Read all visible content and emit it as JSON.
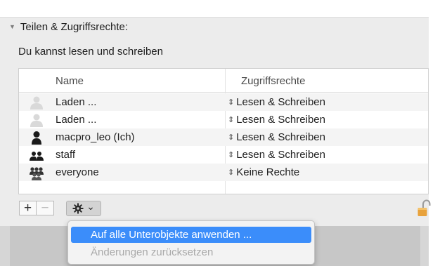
{
  "section": {
    "title": "Teilen & Zugriffsrechte:",
    "disclosure": "▼",
    "permission_note": "Du kannst lesen und schreiben"
  },
  "table": {
    "columns": [
      "Name",
      "Zugriffsrechte"
    ],
    "rows": [
      {
        "icon": "user-placeholder-icon",
        "name": "Laden ...",
        "permission": "Lesen & Schreiben"
      },
      {
        "icon": "user-placeholder-icon",
        "name": "Laden ...",
        "permission": "Lesen & Schreiben"
      },
      {
        "icon": "user-icon",
        "name": "macpro_leo (Ich)",
        "permission": "Lesen & Schreiben"
      },
      {
        "icon": "group-icon",
        "name": "staff",
        "permission": "Lesen & Schreiben"
      },
      {
        "icon": "everyone-icon",
        "name": "everyone",
        "permission": "Keine Rechte"
      }
    ]
  },
  "toolbar": {
    "add_label": "+",
    "remove_label": "−",
    "gear_chevron": "⌄",
    "updown_glyph": "⇕"
  },
  "context_menu": {
    "items": [
      {
        "label": "Auf alle Unterobjekte anwenden ...",
        "state": "highlighted"
      },
      {
        "label": "Änderungen zurücksetzen",
        "state": "disabled"
      }
    ]
  },
  "colors": {
    "panel": "#ececec",
    "highlight": "#3b8dfa",
    "lock": "#e8a23c"
  }
}
